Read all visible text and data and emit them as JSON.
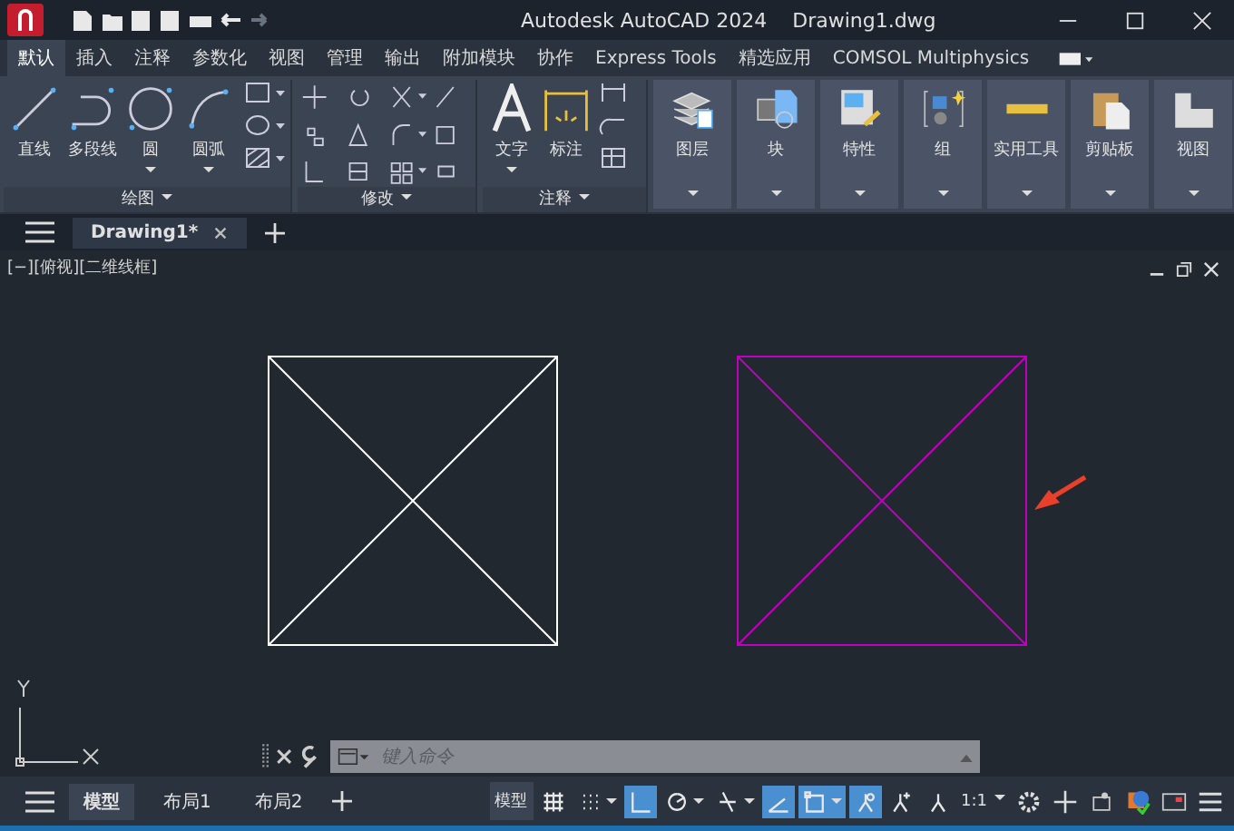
{
  "window": {
    "title": "Autodesk AutoCAD 2024",
    "document": "Drawing1.dwg"
  },
  "ribbon_tabs": [
    {
      "label": "默认",
      "selected": true
    },
    {
      "label": "插入",
      "selected": false
    },
    {
      "label": "注释",
      "selected": false
    },
    {
      "label": "参数化",
      "selected": false
    },
    {
      "label": "视图",
      "selected": false
    },
    {
      "label": "管理",
      "selected": false
    },
    {
      "label": "输出",
      "selected": false
    },
    {
      "label": "附加模块",
      "selected": false
    },
    {
      "label": "协作",
      "selected": false
    },
    {
      "label": "Express Tools",
      "selected": false
    },
    {
      "label": "精选应用",
      "selected": false
    },
    {
      "label": "COMSOL Multiphysics",
      "selected": false
    }
  ],
  "panels": [
    {
      "kind": "draw",
      "title": "绘图",
      "tools": [
        "直线",
        "多段线",
        "圆",
        "圆弧"
      ]
    },
    {
      "kind": "modify",
      "title": "修改"
    },
    {
      "kind": "annotate",
      "title": "注释",
      "tools": [
        "文字",
        "标注"
      ]
    }
  ],
  "big_panels": [
    "图层",
    "块",
    "特性",
    "组",
    "实用工具",
    "剪贴板",
    "视图"
  ],
  "file_tabs": [
    {
      "label": "Drawing1*",
      "selected": true
    }
  ],
  "viewport_label": "[−][俯视][二维线框]",
  "objects": [
    {
      "kind": "crossed-square",
      "color": "#ffffff"
    },
    {
      "kind": "crossed-square",
      "color": "#c000c0"
    },
    {
      "kind": "arrow",
      "color": "#e8402a"
    }
  ],
  "command_line": {
    "placeholder": "键入命令"
  },
  "layout_tabs": [
    {
      "label": "模型",
      "selected": true
    },
    {
      "label": "布局1",
      "selected": false
    },
    {
      "label": "布局2",
      "selected": false
    }
  ],
  "status": {
    "model_label": "模型",
    "scale": "1:1",
    "toggles": [
      {
        "on": false
      },
      {
        "on": false
      },
      {
        "on": true
      },
      {
        "on": false
      },
      {
        "on": false
      },
      {
        "on": true
      },
      {
        "on": true
      },
      {
        "on": true
      },
      {
        "on": false
      },
      {
        "on": false
      }
    ]
  }
}
